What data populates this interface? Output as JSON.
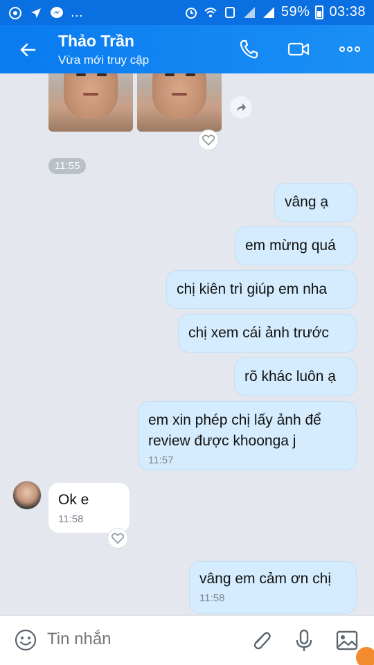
{
  "status_bar": {
    "battery": "59%",
    "time": "03:38",
    "more": "..."
  },
  "header": {
    "contact_name": "Thảo Trần",
    "presence": "Vừa mới truy cập"
  },
  "chat": {
    "timestamp_pill": "11:55",
    "messages": [
      {
        "direction": "out",
        "text": "vâng ạ"
      },
      {
        "direction": "out",
        "text": "em mừng quá"
      },
      {
        "direction": "out",
        "text": "chị kiên trì giúp em nha"
      },
      {
        "direction": "out",
        "text": "chị xem cái ảnh trước"
      },
      {
        "direction": "out",
        "text": "rõ khác luôn ạ"
      },
      {
        "direction": "out",
        "text": "em xin phép chị lấy ảnh để review được khoonga j",
        "time": "11:57"
      },
      {
        "direction": "in",
        "text": "Ok e",
        "time": "11:58"
      },
      {
        "direction": "out",
        "text": "vâng em cảm ơn chị",
        "time": "11:58"
      }
    ]
  },
  "composer": {
    "placeholder": "Tin nhắn"
  },
  "colors": {
    "header_blue": "#0a7bf0",
    "outgoing_bubble": "#d4ecfd",
    "incoming_bubble": "#ffffff",
    "background": "#e4e8ee"
  },
  "icons": [
    "back-arrow-icon",
    "phone-icon",
    "video-call-icon",
    "more-options-icon",
    "share-icon",
    "heart-icon",
    "emoji-icon",
    "attachment-icon",
    "microphone-icon",
    "image-icon"
  ]
}
